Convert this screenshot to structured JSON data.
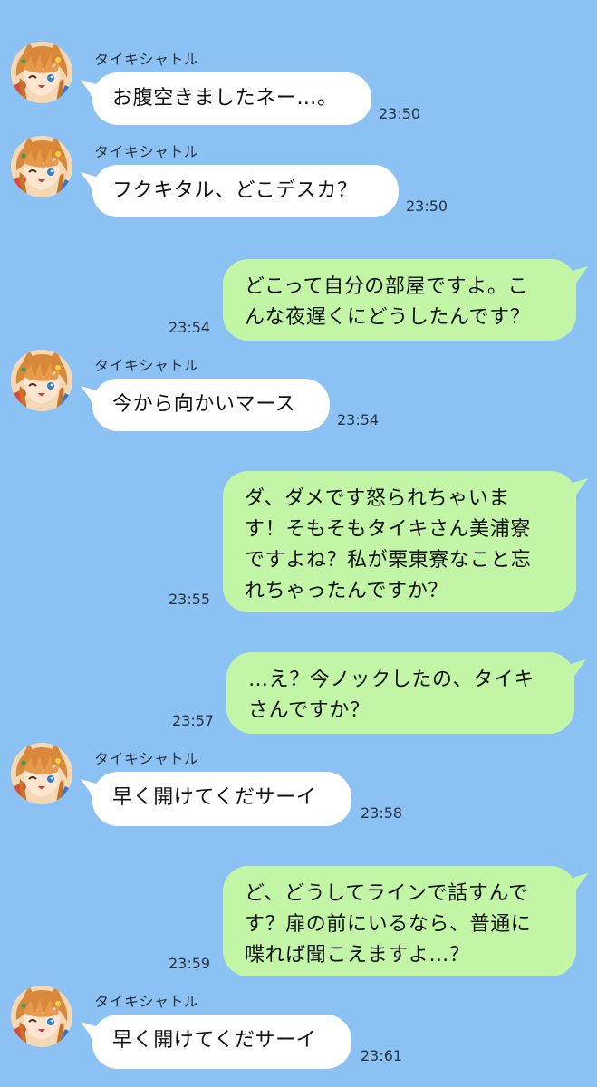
{
  "theme": {
    "background": "#8cc1f4",
    "incoming_bubble": "#ffffff",
    "outgoing_bubble": "#c2f6a6"
  },
  "sender_name": "タイキシャトル",
  "messages": [
    {
      "direction": "incoming",
      "sender": "タイキシャトル",
      "avatar": "taiki-shuttle-avatar-icon",
      "text": "お腹空きましたネー…。",
      "time": "23:50"
    },
    {
      "direction": "incoming",
      "sender": "タイキシャトル",
      "avatar": "taiki-shuttle-avatar-icon",
      "text": "フクキタル、どこデスカ？",
      "time": "23:50"
    },
    {
      "direction": "outgoing",
      "text": "どこって自分の部屋ですよ。こ\nんな夜遅くにどうしたんです？",
      "time": "23:54"
    },
    {
      "direction": "incoming",
      "sender": "タイキシャトル",
      "avatar": "taiki-shuttle-avatar-icon",
      "text": "今から向かいマース",
      "time": "23:54"
    },
    {
      "direction": "outgoing",
      "text": "ダ、ダメです怒られちゃいま\nす！そもそもタイキさん美浦寮\nですよね？私が栗東寮なこと忘\nれちゃったんですか？",
      "time": "23:55"
    },
    {
      "direction": "outgoing",
      "text": "…え？今ノックしたの、タイキ\nさんですか？",
      "time": "23:57"
    },
    {
      "direction": "incoming",
      "sender": "タイキシャトル",
      "avatar": "taiki-shuttle-avatar-icon",
      "text": "早く開けてくだサーイ",
      "time": "23:58"
    },
    {
      "direction": "outgoing",
      "text": "ど、どうしてラインで話すんで\nす？扉の前にいるなら、普通に\n喋れば聞こえますよ…？",
      "time": "23:59"
    },
    {
      "direction": "incoming",
      "sender": "タイキシャトル",
      "avatar": "taiki-shuttle-avatar-icon",
      "text": "早く開けてくだサーイ",
      "time": "23:61"
    }
  ]
}
